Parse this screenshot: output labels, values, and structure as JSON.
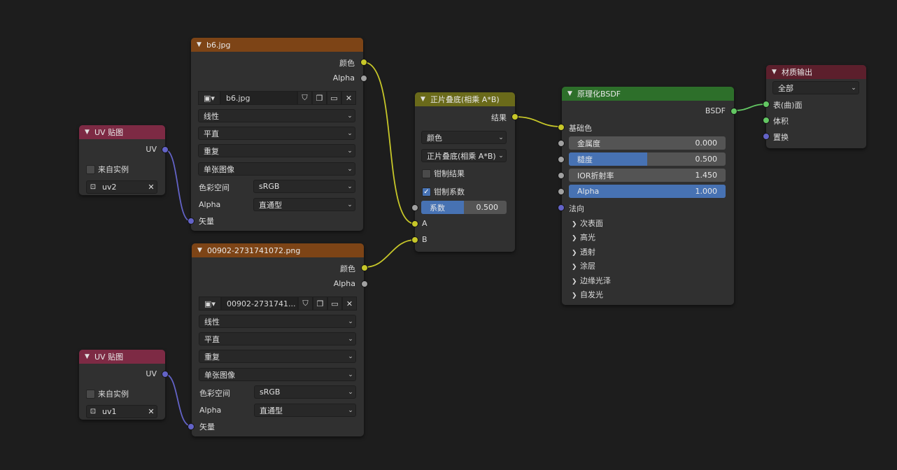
{
  "image_node_1": {
    "title": "b6.jpg",
    "out_color": "颜色",
    "out_alpha": "Alpha",
    "image_name": "b6.jpg",
    "interpolation": "线性",
    "projection": "平直",
    "extension": "重复",
    "source": "单张图像",
    "colorspace_label": "色彩空间",
    "colorspace_value": "sRGB",
    "alpha_label": "Alpha",
    "alpha_value": "直通型",
    "in_vector": "矢量"
  },
  "image_node_2": {
    "title": "00902-2731741072.png",
    "out_color": "颜色",
    "out_alpha": "Alpha",
    "image_name": "00902-2731741...",
    "interpolation": "线性",
    "projection": "平直",
    "extension": "重复",
    "source": "单张图像",
    "colorspace_label": "色彩空间",
    "colorspace_value": "sRGB",
    "alpha_label": "Alpha",
    "alpha_value": "直通型",
    "in_vector": "矢量"
  },
  "uv_node_1": {
    "title": "UV 贴图",
    "out_uv": "UV",
    "from_instancer": "来自实例",
    "uv_map": "uv2"
  },
  "uv_node_2": {
    "title": "UV 贴图",
    "out_uv": "UV",
    "from_instancer": "来自实例",
    "uv_map": "uv1"
  },
  "mix_node": {
    "title": "正片叠底(相乘 A*B)",
    "out_result": "结果",
    "data_type": "颜色",
    "blend_mode": "正片叠底(相乘 A*B)",
    "clamp_result": "钳制结果",
    "clamp_factor": "钳制系数",
    "factor_label": "系数",
    "factor_value": "0.500",
    "factor_fill": 0.5,
    "in_a": "A",
    "in_b": "B"
  },
  "bsdf_node": {
    "title": "原理化BSDF",
    "out_bsdf": "BSDF",
    "base_color": "基础色",
    "metallic_label": "金属度",
    "metallic_value": "0.000",
    "metallic_fill": 0.0,
    "roughness_label": "糙度",
    "roughness_value": "0.500",
    "roughness_fill": 0.5,
    "ior_label": "IOR折射率",
    "ior_value": "1.450",
    "ior_fill": 0.0,
    "alpha_label": "Alpha",
    "alpha_value": "1.000",
    "alpha_fill": 1.0,
    "normal": "法向",
    "panels": [
      "次表面",
      "高光",
      "透射",
      "涂层",
      "边缘光泽",
      "自发光"
    ]
  },
  "output_node": {
    "title": "材质输出",
    "target": "全部",
    "in_surface": "表(曲)面",
    "in_volume": "体积",
    "in_displacement": "置换"
  },
  "colors": {
    "link_yellow": "#c7c729",
    "link_blue": "#6363c7",
    "link_green": "#63c763",
    "accent": "#4772b3"
  },
  "icons": {
    "collapse": "chevron-down-icon",
    "image": "image-icon",
    "shield": "fake-user-shield-icon",
    "duplicate": "duplicate-icon",
    "folder": "folder-icon",
    "close": "close-icon",
    "uv": "uv-icon"
  }
}
